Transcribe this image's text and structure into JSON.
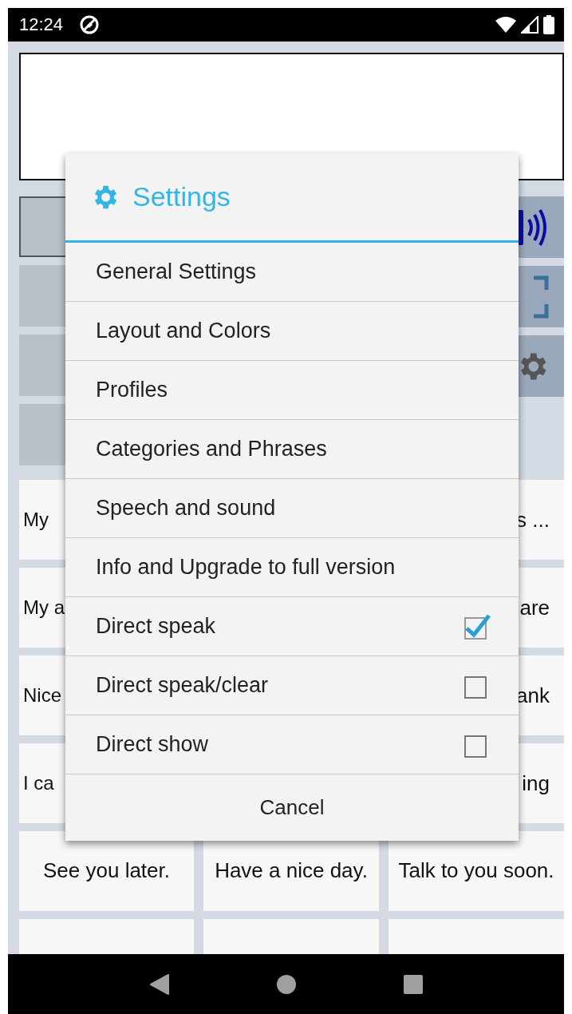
{
  "status_bar": {
    "time": "12:24"
  },
  "right_buttons": [
    {
      "kind": "speak"
    },
    {
      "kind": "fullscreen"
    },
    {
      "kind": "settings"
    }
  ],
  "phrase_rows": [
    {
      "kind": "partial",
      "left": "My",
      "right": "s ..."
    },
    {
      "kind": "partial",
      "left": "My a",
      "right": "are"
    },
    {
      "kind": "partial",
      "left": "Nice",
      "right": "ank"
    },
    {
      "kind": "partial",
      "left": "I ca",
      "right": "ing"
    },
    {
      "kind": "full",
      "cells": [
        "See you later.",
        "Have a nice day.",
        "Talk to you soon."
      ]
    }
  ],
  "dialog": {
    "title": "Settings",
    "items": [
      {
        "kind": "link",
        "label": "General Settings"
      },
      {
        "kind": "link",
        "label": "Layout and Colors"
      },
      {
        "kind": "link",
        "label": "Profiles"
      },
      {
        "kind": "link",
        "label": "Categories and Phrases"
      },
      {
        "kind": "link",
        "label": "Speech and sound"
      },
      {
        "kind": "link",
        "label": "Info and Upgrade to full version"
      },
      {
        "kind": "check",
        "label": "Direct speak",
        "checked": true
      },
      {
        "kind": "check",
        "label": "Direct speak/clear",
        "checked": false
      },
      {
        "kind": "check",
        "label": "Direct show",
        "checked": false
      }
    ],
    "cancel": "Cancel"
  }
}
